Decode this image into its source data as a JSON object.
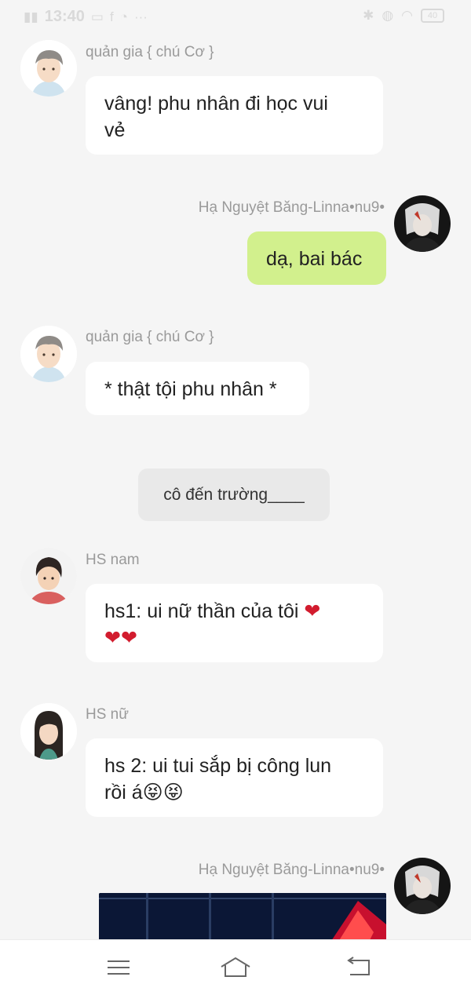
{
  "status_bar": {
    "time": "13:40",
    "battery": "40"
  },
  "messages": [
    {
      "sender": "quản gia { chú Cơ }",
      "lines": [
        "vâng! phu nhân đi học vui",
        "vẻ"
      ]
    },
    {
      "sender": "Hạ Nguyệt Băng-Linna•nu9•",
      "text": "dạ, bai bác"
    },
    {
      "sender": "quản gia { chú Cơ }",
      "text": "* thật tội phu nhân *"
    },
    {
      "system": "cô đến trường____"
    },
    {
      "sender": "HS nam",
      "line1": "hs1: ui nữ thần của tôi",
      "line1_emoji": "❤",
      "line2_emoji": "❤❤"
    },
    {
      "sender": "HS nữ",
      "line1": "hs 2: ui tui sắp bị công lun",
      "line2": "rồi á",
      "line2_emoji": "😝😝"
    },
    {
      "sender": "Hạ Nguyệt Băng-Linna•nu9•"
    }
  ],
  "nav": {
    "menu_icon": "menu-icon",
    "home_icon": "home-icon",
    "back_icon": "back-icon"
  },
  "colors": {
    "my_bubble": "#d2f08d",
    "other_bubble": "#ffffff",
    "background": "#f5f5f5",
    "heart": "#d21c2e"
  }
}
